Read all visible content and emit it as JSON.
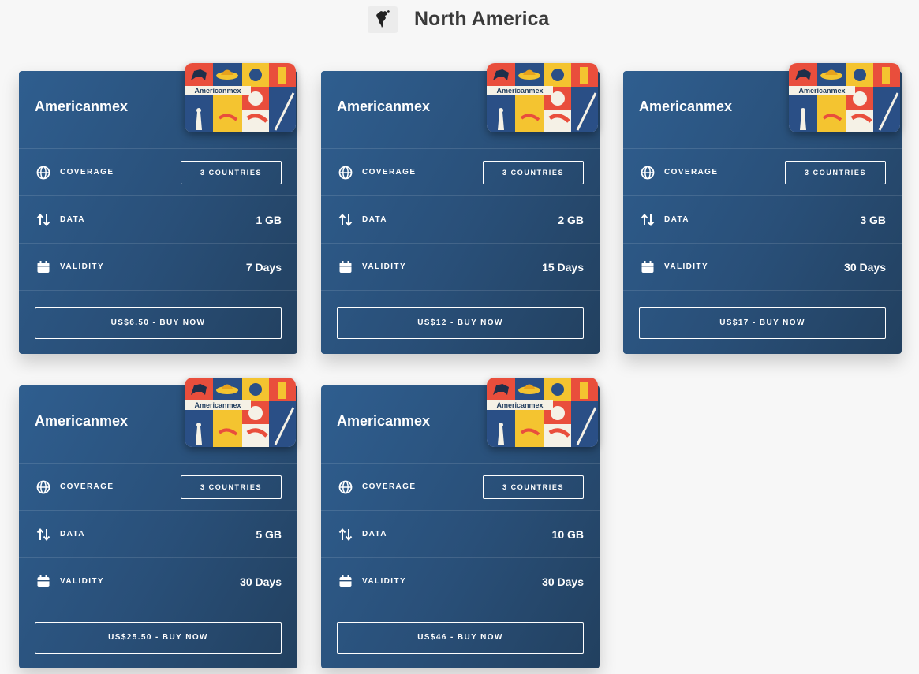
{
  "region": {
    "title": "North America",
    "icon": "north-america-map-icon"
  },
  "labels": {
    "coverage": "COVERAGE",
    "data": "DATA",
    "validity": "VALIDITY"
  },
  "icons": {
    "coverage": "globe-icon",
    "data": "up-down-arrows-icon",
    "validity": "calendar-icon"
  },
  "colors": {
    "card_start": "#2f5e8f",
    "card_end": "#22405f",
    "page_bg": "#f7f7f7"
  },
  "art_label": "Americanmex",
  "plans": [
    {
      "name": "Americanmex",
      "coverage": "3 COUNTRIES",
      "data": "1 GB",
      "validity": "7 Days",
      "buy": "US$6.50 - BUY NOW"
    },
    {
      "name": "Americanmex",
      "coverage": "3 COUNTRIES",
      "data": "2 GB",
      "validity": "15 Days",
      "buy": "US$12 - BUY NOW"
    },
    {
      "name": "Americanmex",
      "coverage": "3 COUNTRIES",
      "data": "3 GB",
      "validity": "30 Days",
      "buy": "US$17 - BUY NOW"
    },
    {
      "name": "Americanmex",
      "coverage": "3 COUNTRIES",
      "data": "5 GB",
      "validity": "30 Days",
      "buy": "US$25.50 - BUY NOW"
    },
    {
      "name": "Americanmex",
      "coverage": "3 COUNTRIES",
      "data": "10 GB",
      "validity": "30 Days",
      "buy": "US$46 - BUY NOW"
    }
  ]
}
